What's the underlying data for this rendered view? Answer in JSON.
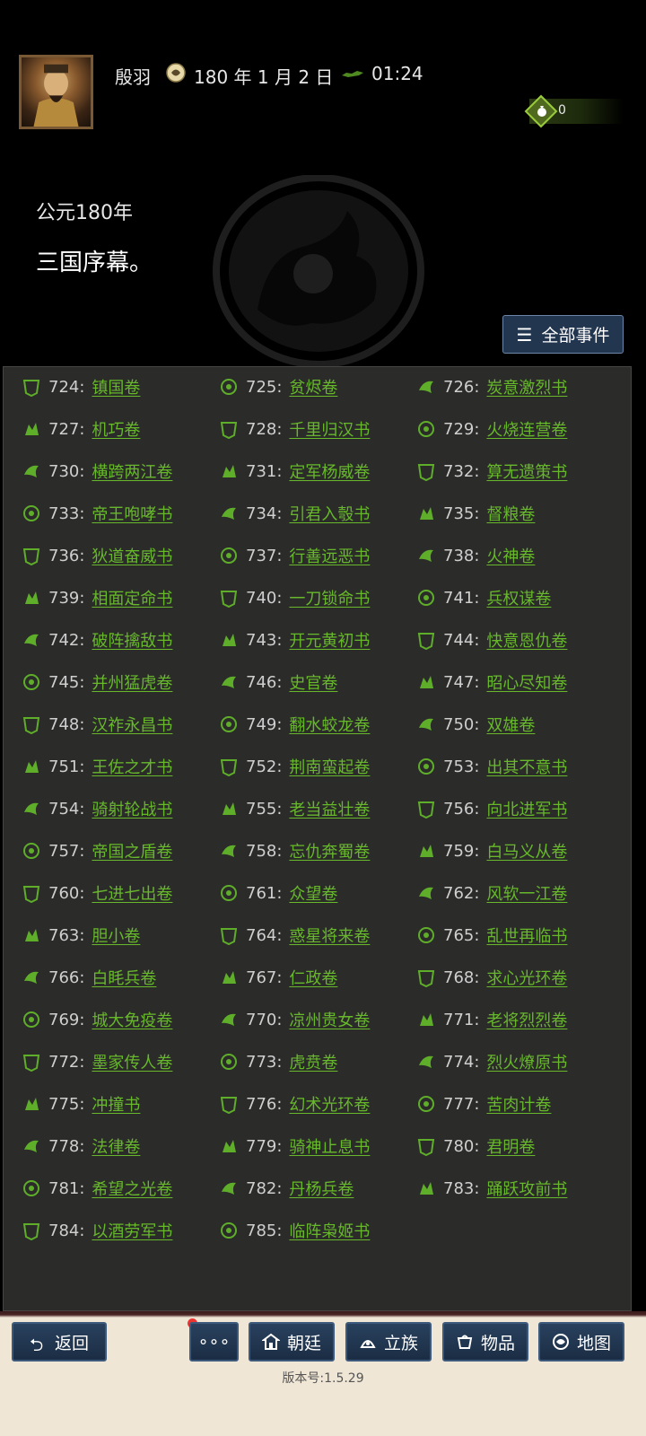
{
  "header": {
    "player_name": "殷羽",
    "date": "180 年 1 月 2 日",
    "time": "01:24",
    "resource_count": "0"
  },
  "intro": {
    "era": "公元180年",
    "headline": "三国序幕。"
  },
  "all_events_button": {
    "label": "全部事件"
  },
  "books": [
    {
      "num": "724:",
      "title": "镇国卷"
    },
    {
      "num": "725:",
      "title": "贫烬卷"
    },
    {
      "num": "726:",
      "title": "炭意激烈书"
    },
    {
      "num": "727:",
      "title": "机巧卷"
    },
    {
      "num": "728:",
      "title": "千里归汉书"
    },
    {
      "num": "729:",
      "title": "火烧连营卷"
    },
    {
      "num": "730:",
      "title": "横跨两江卷"
    },
    {
      "num": "731:",
      "title": "定军杨威卷"
    },
    {
      "num": "732:",
      "title": "算无遗策书"
    },
    {
      "num": "733:",
      "title": "帝王咆哮书"
    },
    {
      "num": "734:",
      "title": "引君入彀书"
    },
    {
      "num": "735:",
      "title": "督粮卷"
    },
    {
      "num": "736:",
      "title": "狄道奋威书"
    },
    {
      "num": "737:",
      "title": "行善远恶书"
    },
    {
      "num": "738:",
      "title": "火神卷"
    },
    {
      "num": "739:",
      "title": "相面定命书"
    },
    {
      "num": "740:",
      "title": "一刀锁命书"
    },
    {
      "num": "741:",
      "title": "兵权谋卷"
    },
    {
      "num": "742:",
      "title": "破阵擒敌书"
    },
    {
      "num": "743:",
      "title": "开元黄初书"
    },
    {
      "num": "744:",
      "title": "快意恩仇卷"
    },
    {
      "num": "745:",
      "title": "并州猛虎卷"
    },
    {
      "num": "746:",
      "title": "史官卷"
    },
    {
      "num": "747:",
      "title": "昭心尽知卷"
    },
    {
      "num": "748:",
      "title": "汉祚永昌书"
    },
    {
      "num": "749:",
      "title": "翻水蛟龙卷"
    },
    {
      "num": "750:",
      "title": "双雄卷"
    },
    {
      "num": "751:",
      "title": "王佐之才书"
    },
    {
      "num": "752:",
      "title": "荆南蛮起卷"
    },
    {
      "num": "753:",
      "title": "出其不意书"
    },
    {
      "num": "754:",
      "title": "骑射轮战书"
    },
    {
      "num": "755:",
      "title": "老当益壮卷"
    },
    {
      "num": "756:",
      "title": "向北进军书"
    },
    {
      "num": "757:",
      "title": "帝国之盾卷"
    },
    {
      "num": "758:",
      "title": "忘仇奔蜀卷"
    },
    {
      "num": "759:",
      "title": "白马义从卷"
    },
    {
      "num": "760:",
      "title": "七进七出卷"
    },
    {
      "num": "761:",
      "title": "众望卷"
    },
    {
      "num": "762:",
      "title": "风软一江卷"
    },
    {
      "num": "763:",
      "title": "胆小卷"
    },
    {
      "num": "764:",
      "title": "惑星将来卷"
    },
    {
      "num": "765:",
      "title": "乱世再临书"
    },
    {
      "num": "766:",
      "title": "白眊兵卷"
    },
    {
      "num": "767:",
      "title": "仁政卷"
    },
    {
      "num": "768:",
      "title": "求心光环卷"
    },
    {
      "num": "769:",
      "title": "城大免疫卷"
    },
    {
      "num": "770:",
      "title": "凉州贵女卷"
    },
    {
      "num": "771:",
      "title": "老将烈烈卷"
    },
    {
      "num": "772:",
      "title": "墨家传人卷"
    },
    {
      "num": "773:",
      "title": "虎贲卷"
    },
    {
      "num": "774:",
      "title": "烈火燎原书"
    },
    {
      "num": "775:",
      "title": "冲撞书"
    },
    {
      "num": "776:",
      "title": "幻术光环卷"
    },
    {
      "num": "777:",
      "title": "苦肉计卷"
    },
    {
      "num": "778:",
      "title": "法律卷"
    },
    {
      "num": "779:",
      "title": "骑神止息书"
    },
    {
      "num": "780:",
      "title": "君明卷"
    },
    {
      "num": "781:",
      "title": "希望之光卷"
    },
    {
      "num": "782:",
      "title": "丹杨兵卷"
    },
    {
      "num": "783:",
      "title": "踊跃攻前书"
    },
    {
      "num": "784:",
      "title": "以酒劳军书"
    },
    {
      "num": "785:",
      "title": "临阵枭姬书"
    }
  ],
  "bottom_nav": {
    "back": "返回",
    "more": "∘∘∘",
    "court": "朝廷",
    "clan": "立族",
    "items": "物品",
    "map": "地图"
  },
  "version": "版本号:1.5.29",
  "colors": {
    "link_green": "#67b82a",
    "panel_bg": "#2b2b2a",
    "button_blue": "#23364f"
  }
}
